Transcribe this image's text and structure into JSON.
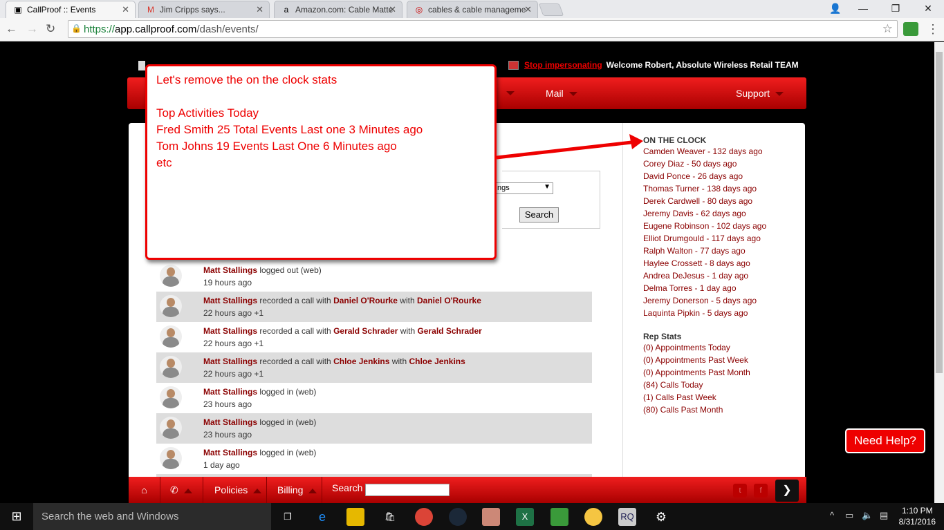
{
  "browser": {
    "tabs": [
      {
        "title": "CallProof :: Events",
        "fav": "▣",
        "favcolor": "#000"
      },
      {
        "title": "Jim Cripps says...",
        "fav": "M",
        "favcolor": "#d93025"
      },
      {
        "title": "Amazon.com: Cable Matte",
        "fav": "a",
        "favcolor": "#000"
      },
      {
        "title": "cables & cable manageme",
        "fav": "◎",
        "favcolor": "#cc0000"
      }
    ],
    "url_scheme": "https://",
    "url_host": "app.callproof.com",
    "url_path": "/dash/events/"
  },
  "header": {
    "stop_impersonating": "Stop impersonating",
    "welcome": "Welcome Robert, Absolute Wireless Retail TEAM",
    "nav": {
      "mail": "Mail",
      "support": "Support"
    }
  },
  "search": {
    "select_fragment": "ngs",
    "button": "Search"
  },
  "feed": [
    {
      "user": "Matt Stallings",
      "action": " logged out (web)",
      "target": "",
      "mid": "",
      "target2": "",
      "time": "19 hours ago"
    },
    {
      "user": "Matt Stallings",
      "action": " recorded a call with ",
      "target": "Daniel O'Rourke",
      "mid": " with ",
      "target2": "Daniel O'Rourke",
      "time": "22 hours ago +1"
    },
    {
      "user": "Matt Stallings",
      "action": " recorded a call with ",
      "target": "Gerald Schrader",
      "mid": " with ",
      "target2": "Gerald Schrader",
      "time": "22 hours ago +1"
    },
    {
      "user": "Matt Stallings",
      "action": " recorded a call with ",
      "target": "Chloe Jenkins",
      "mid": " with ",
      "target2": "Chloe Jenkins",
      "time": "22 hours ago +1"
    },
    {
      "user": "Matt Stallings",
      "action": " logged in (web)",
      "target": "",
      "mid": "",
      "target2": "",
      "time": "23 hours ago"
    },
    {
      "user": "Matt Stallings",
      "action": " logged in (web)",
      "target": "",
      "mid": "",
      "target2": "",
      "time": "23 hours ago"
    },
    {
      "user": "Matt Stallings",
      "action": " logged in (web)",
      "target": "",
      "mid": "",
      "target2": "",
      "time": "1 day ago"
    }
  ],
  "sidebar": {
    "on_clock_title": "ON THE CLOCK",
    "on_clock": [
      "Camden Weaver - 132 days ago",
      "Corey Diaz - 50 days ago",
      "David Ponce - 26 days ago",
      "Thomas Turner - 138 days ago",
      "Derek Cardwell - 80 days ago",
      "Jeremy Davis - 62 days ago",
      "Eugene Robinson - 102 days ago",
      "Elliot Drumgould - 117 days ago",
      "Ralph Walton - 77 days ago",
      "Haylee Crossett - 8 days ago",
      "Andrea DeJesus - 1 day ago",
      "Delma Torres - 1 day ago",
      "Jeremy Donerson - 5 days ago",
      "Laquinta Pipkin - 5 days ago"
    ],
    "rep_title": "Rep Stats",
    "rep_stats": [
      "(0) Appointments Today",
      "(0) Appointments Past Week",
      "(0) Appointments Past Month",
      "(84) Calls Today",
      "(1) Calls Past Week",
      "(80) Calls Past Month"
    ]
  },
  "footer": {
    "policies": "Policies",
    "billing": "Billing",
    "search": "Search"
  },
  "help": "Need Help?",
  "annotation": {
    "line1": "Let's remove the on the clock stats",
    "line2": "Top Activities Today",
    "line3": "Fred Smith 25 Total Events Last one 3 Minutes ago",
    "line4": "Tom Johns 19 Events Last One 6 Minutes ago",
    "line5": "etc"
  },
  "taskbar": {
    "search": "Search the web and Windows",
    "time": "1:10 PM",
    "date": "8/31/2016"
  },
  "colors": {
    "brand_red": "#e00000",
    "link": "#8b0000"
  }
}
